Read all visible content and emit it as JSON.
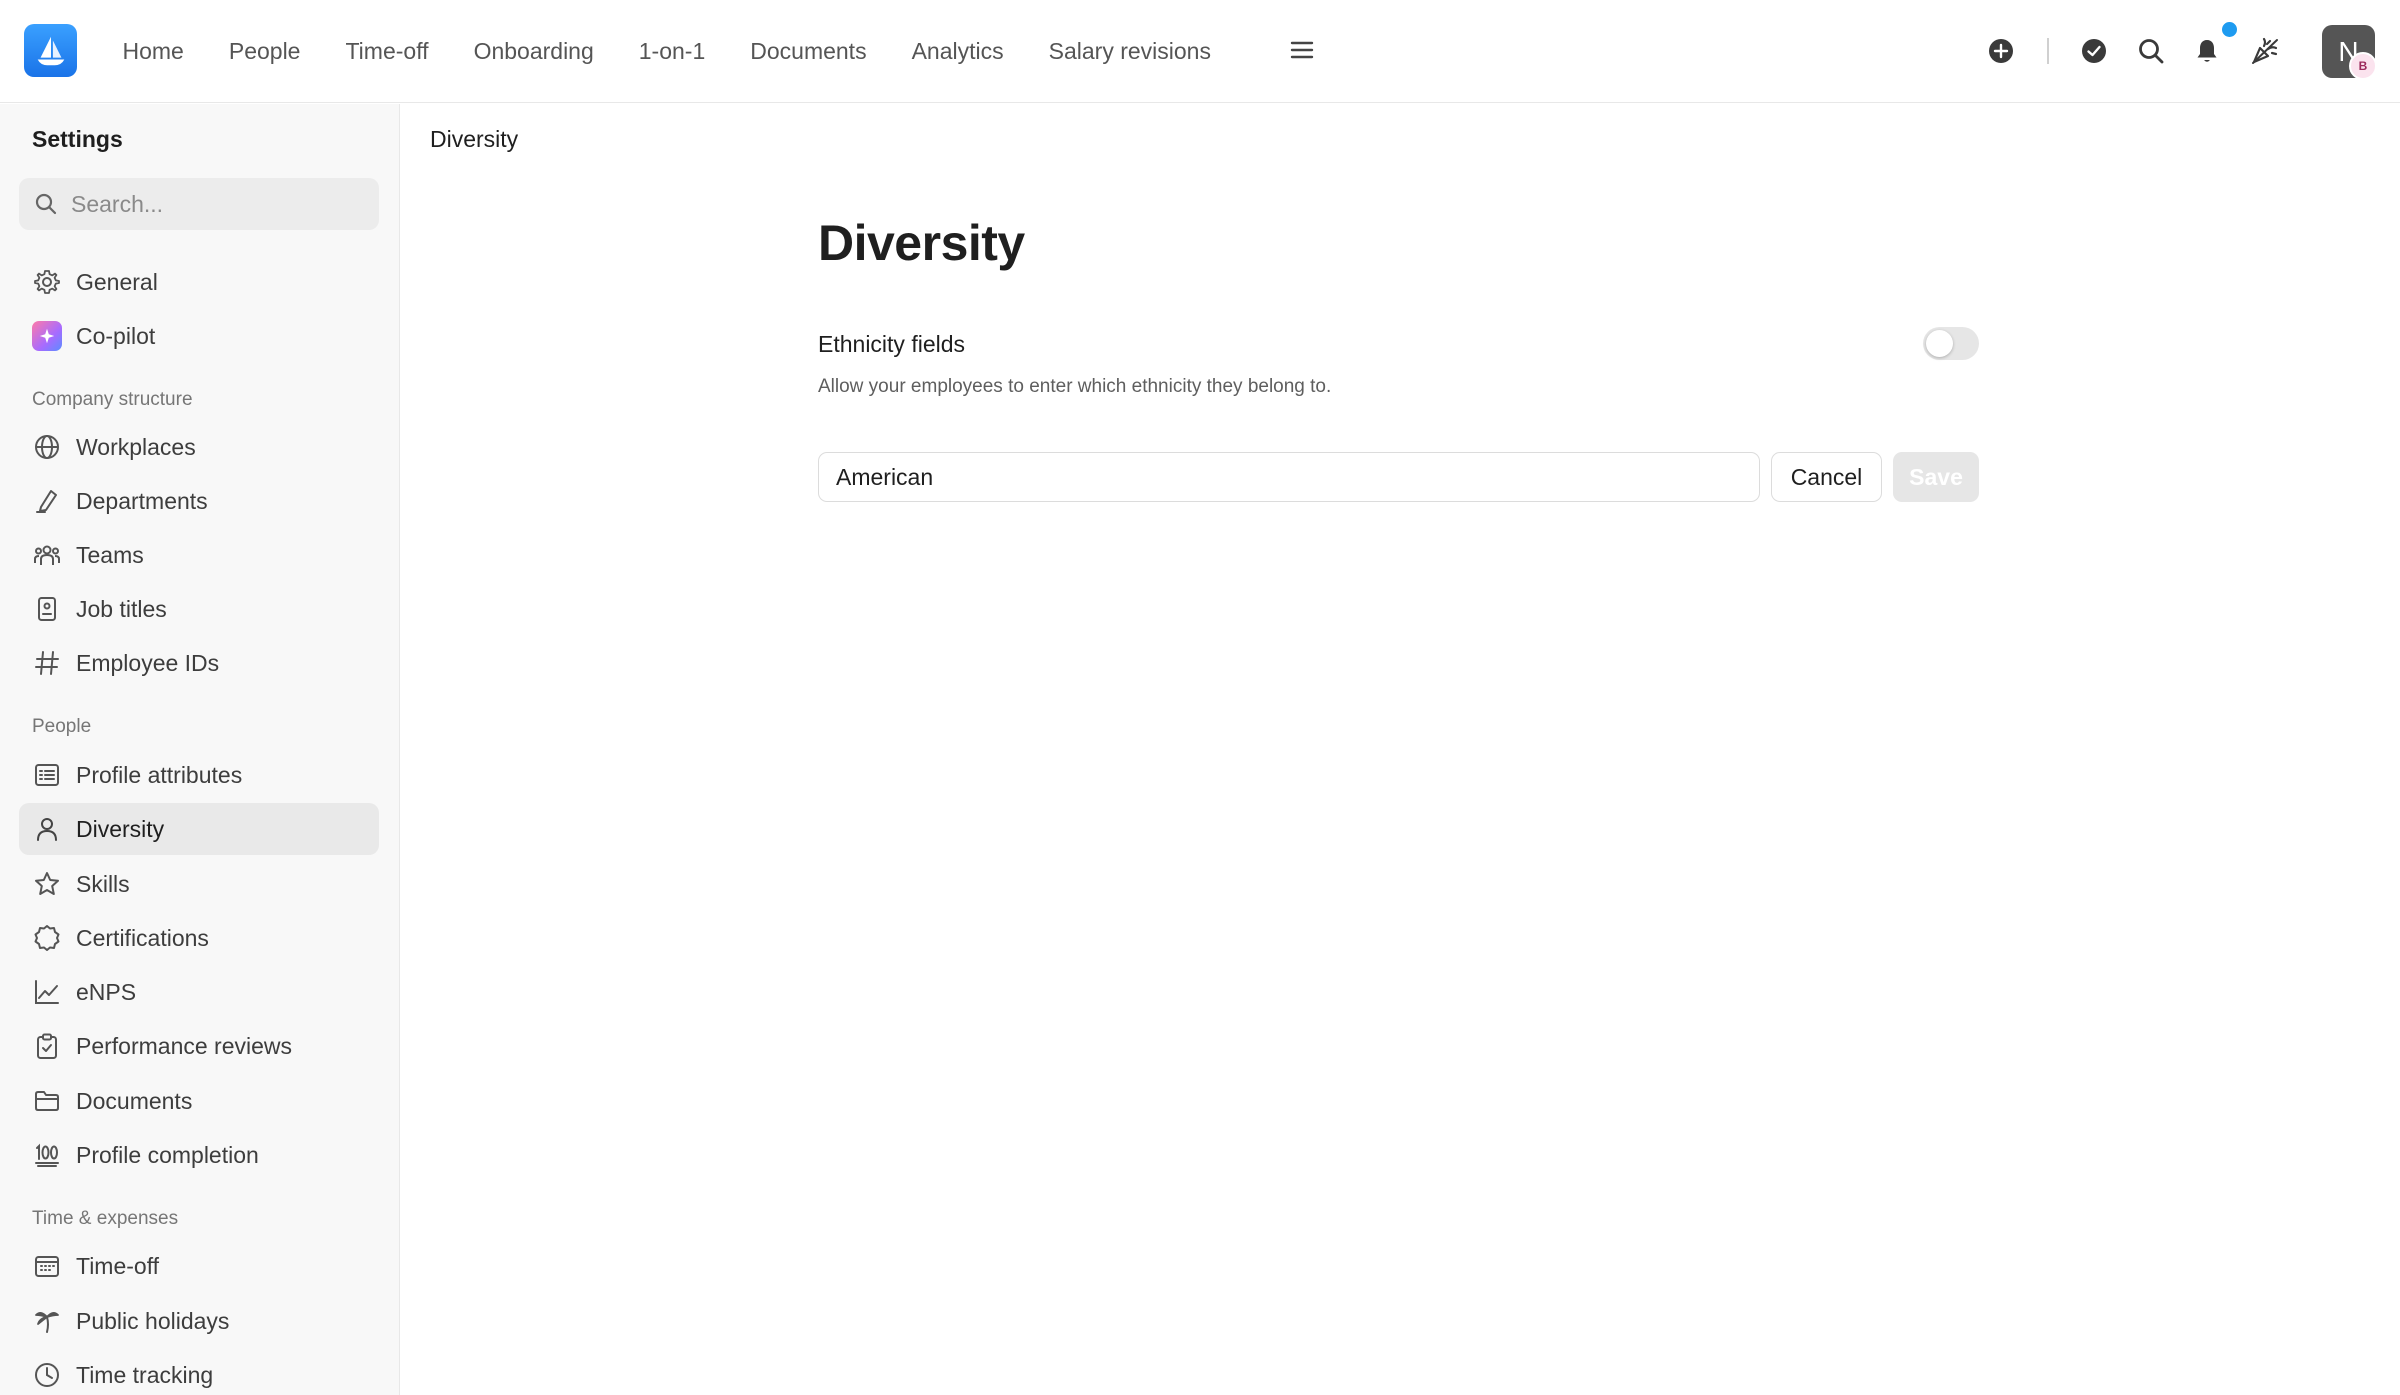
{
  "topbar": {
    "nav": [
      "Home",
      "People",
      "Time-off",
      "Onboarding",
      "1-on-1",
      "Documents",
      "Analytics",
      "Salary revisions"
    ],
    "avatar_initial": "N",
    "avatar_badge": "B",
    "notification_dot_color": "#1e9bf0"
  },
  "sidebar": {
    "title": "Settings",
    "search_placeholder": "Search...",
    "top_items": [
      {
        "label": "General",
        "icon": "gear-icon"
      },
      {
        "label": "Co-pilot",
        "icon": "copilot-icon"
      }
    ],
    "sections": [
      {
        "title": "Company structure",
        "items": [
          {
            "label": "Workplaces",
            "icon": "globe-icon"
          },
          {
            "label": "Departments",
            "icon": "pen-icon"
          },
          {
            "label": "Teams",
            "icon": "team-icon"
          },
          {
            "label": "Job titles",
            "icon": "badge-icon"
          },
          {
            "label": "Employee IDs",
            "icon": "hash-icon"
          }
        ]
      },
      {
        "title": "People",
        "items": [
          {
            "label": "Profile attributes",
            "icon": "list-icon"
          },
          {
            "label": "Diversity",
            "icon": "user-icon",
            "active": true
          },
          {
            "label": "Skills",
            "icon": "star-icon"
          },
          {
            "label": "Certifications",
            "icon": "certificate-icon"
          },
          {
            "label": "eNPS",
            "icon": "chart-line-icon"
          },
          {
            "label": "Performance reviews",
            "icon": "clipboard-check-icon"
          },
          {
            "label": "Documents",
            "icon": "folder-icon"
          },
          {
            "label": "Profile completion",
            "icon": "hundred-icon"
          }
        ]
      },
      {
        "title": "Time & expenses",
        "items": [
          {
            "label": "Time-off",
            "icon": "calendar-icon"
          },
          {
            "label": "Public holidays",
            "icon": "palm-tree-icon"
          },
          {
            "label": "Time tracking",
            "icon": "clock-icon"
          }
        ]
      }
    ]
  },
  "main": {
    "breadcrumb": "Diversity",
    "title": "Diversity",
    "field_label": "Ethnicity fields",
    "field_help": "Allow your employees to enter which ethnicity they belong to.",
    "toggle_on": false,
    "input_value": "American",
    "cancel_label": "Cancel",
    "save_label": "Save"
  }
}
